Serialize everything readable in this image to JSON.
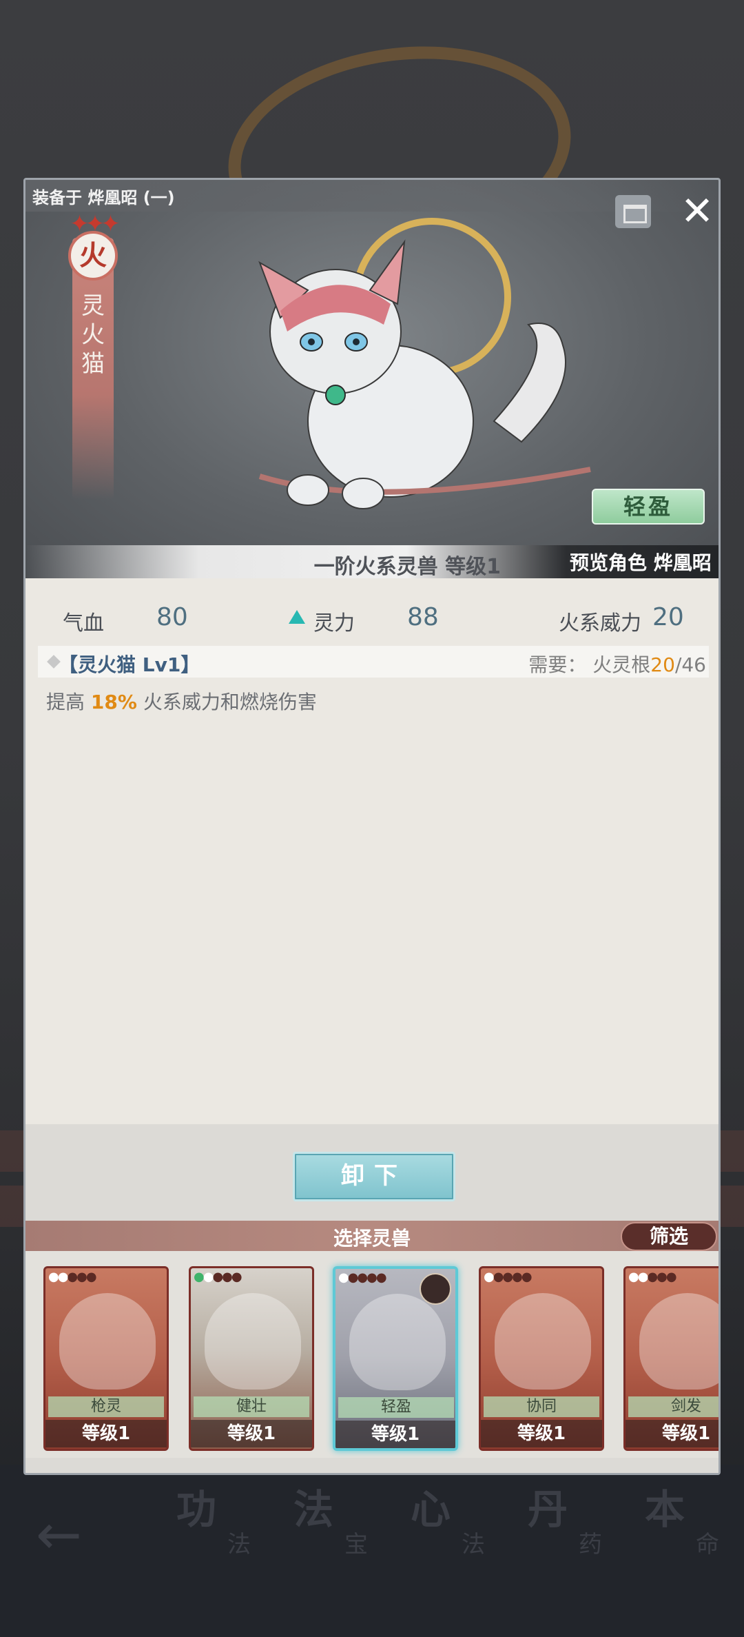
{
  "background": {
    "nav": [
      {
        "big": "功",
        "small": "法"
      },
      {
        "big": "法",
        "small": "宝"
      },
      {
        "big": "心",
        "small": "法"
      },
      {
        "big": "丹",
        "small": "药"
      },
      {
        "big": "本",
        "small": "命"
      }
    ]
  },
  "dialog": {
    "equipped_on": "装备于 烨凰昭 (一)",
    "element": {
      "glyph": "火",
      "beast_name": "灵火猫"
    },
    "trait_button": "轻盈",
    "tier_level": "一阶火系灵兽   等级1",
    "preview": "预览角色 烨凰昭",
    "stats": {
      "hp_label": "气血",
      "hp_value": "80",
      "spirit_label": "灵力",
      "spirit_value": "88",
      "fire_label": "火系威力",
      "fire_value": "20"
    },
    "skill": {
      "name": "【灵火猫 Lv1】",
      "need_label": "需要：",
      "need_item": "火灵根",
      "need_current": "20",
      "need_total": "/46",
      "desc_prefix": "提高 ",
      "desc_pct": "18%",
      "desc_suffix": " 火系威力和燃烧伤害"
    },
    "unequip_button": "卸下",
    "select_title": "选择灵兽",
    "filter_button": "筛选",
    "cards": [
      {
        "name": "枪灵",
        "level": "等级1"
      },
      {
        "name": "健壮",
        "level": "等级1"
      },
      {
        "name": "轻盈",
        "level": "等级1"
      },
      {
        "name": "协同",
        "level": "等级1"
      },
      {
        "name": "剑发",
        "level": "等级1"
      }
    ]
  },
  "colors": {
    "accent_teal": "#5ec9d6",
    "highlight_orange": "#e08a14",
    "stat_blue": "#4f6f80"
  }
}
